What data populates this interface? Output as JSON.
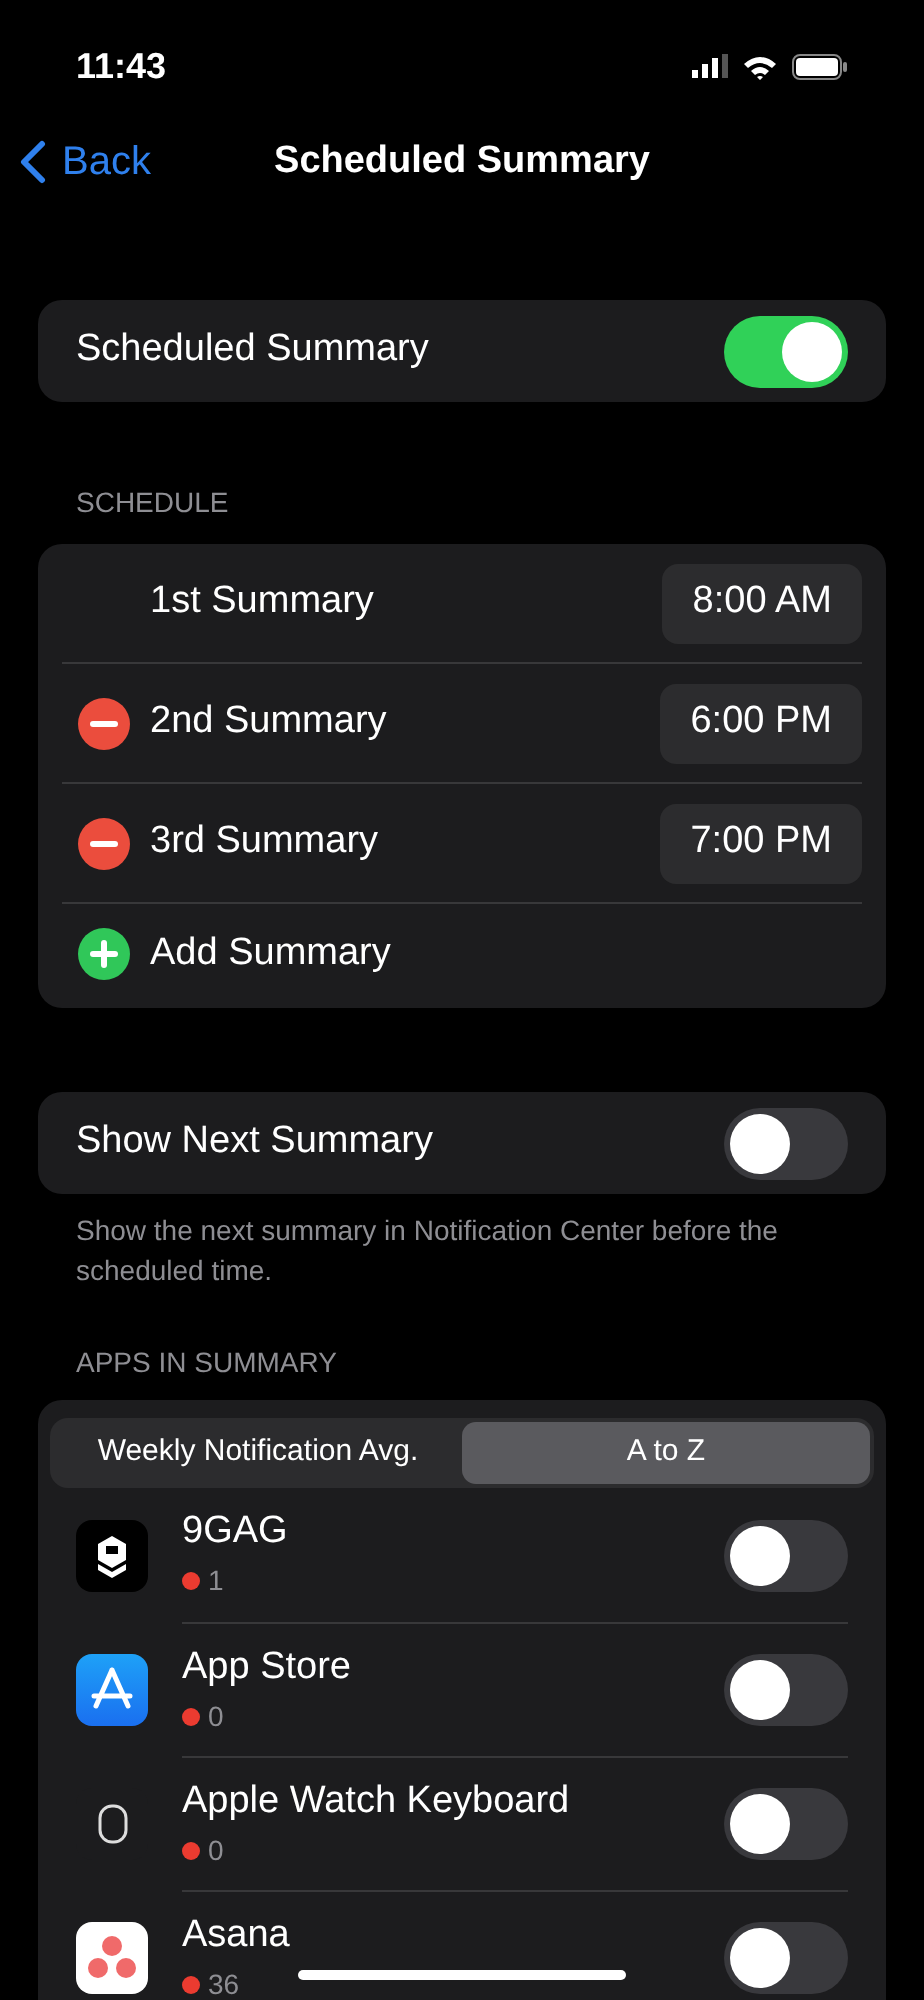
{
  "status_bar": {
    "time": "11:43"
  },
  "nav": {
    "back": "Back",
    "title": "Scheduled Summary"
  },
  "main_toggle": {
    "label": "Scheduled Summary",
    "on": true
  },
  "schedule": {
    "header": "SCHEDULE",
    "rows": [
      {
        "kind": "time",
        "label": "1st Summary",
        "time": "8:00 AM",
        "removable": false
      },
      {
        "kind": "time",
        "label": "2nd Summary",
        "time": "6:00 PM",
        "removable": true
      },
      {
        "kind": "time",
        "label": "3rd Summary",
        "time": "7:00 PM",
        "removable": true
      },
      {
        "kind": "add",
        "label": "Add Summary"
      }
    ]
  },
  "next_summary": {
    "label": "Show Next Summary",
    "on": false,
    "footnote": "Show the next summary in Notification Center before the scheduled time."
  },
  "apps": {
    "header": "APPS IN SUMMARY",
    "sort": [
      {
        "label": "Weekly Notification Avg.",
        "selected": false
      },
      {
        "label": "A to Z",
        "selected": true
      }
    ],
    "items": [
      {
        "name": "9GAG",
        "count": "1",
        "on": false,
        "kind": "black-tile"
      },
      {
        "name": "App Store",
        "count": "0",
        "on": false,
        "kind": "blue-tile"
      },
      {
        "name": "Apple Watch Keyboard",
        "count": "0",
        "on": false,
        "kind": "outline"
      },
      {
        "name": "Asana",
        "count": "36",
        "on": false,
        "kind": "white-tile"
      }
    ]
  }
}
